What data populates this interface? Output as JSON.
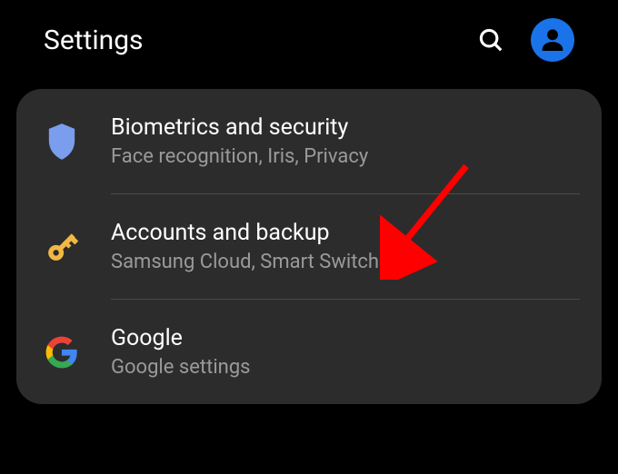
{
  "header": {
    "title": "Settings"
  },
  "items": [
    {
      "title": "Biometrics and security",
      "subtitle": "Face recognition, Iris, Privacy"
    },
    {
      "title": "Accounts and backup",
      "subtitle": "Samsung Cloud, Smart Switch"
    },
    {
      "title": "Google",
      "subtitle": "Google settings"
    }
  ]
}
